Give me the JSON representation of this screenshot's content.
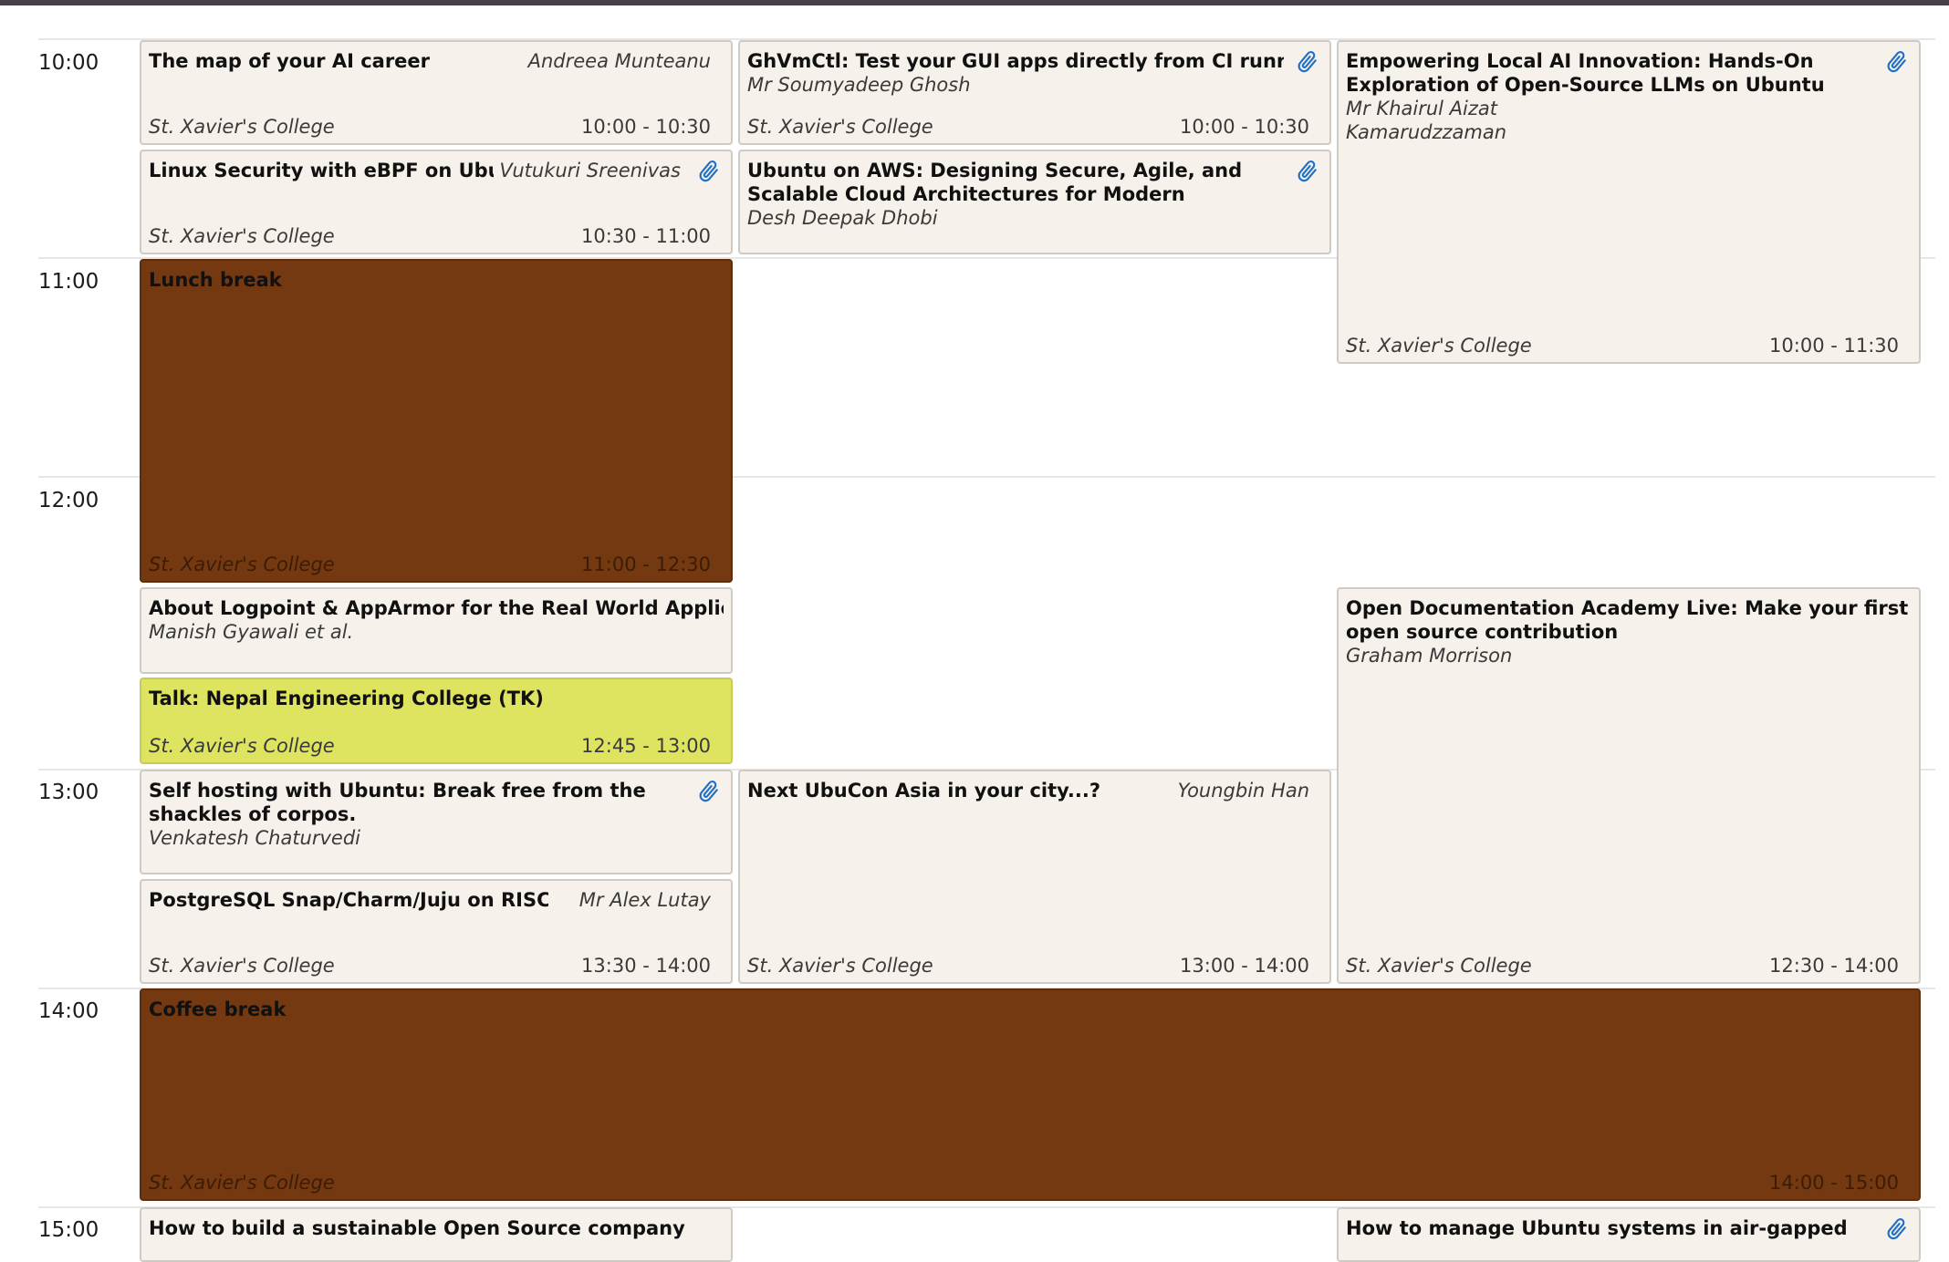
{
  "timeline": {
    "hours": [
      "10:00",
      "11:00",
      "12:00",
      "13:00",
      "14:00",
      "15:00"
    ]
  },
  "colors": {
    "event_bg": "#f6f1ea",
    "break_bg": "#743910",
    "highlight_bg": "#dfe460",
    "attachment_icon": "#1f6fc6"
  },
  "events": {
    "ai_career": {
      "title": "The map of your AI career",
      "speaker": "Andreea Munteanu",
      "location": "St. Xavier's College",
      "time": "10:00 - 10:30"
    },
    "ghvmctl": {
      "title": "GhVmCtl: Test your GUI apps directly from CI runners",
      "speaker": "Mr Soumyadeep Ghosh",
      "location": "St. Xavier's College",
      "time": "10:00 - 10:30",
      "icon": "paperclip-icon"
    },
    "local_ai": {
      "title": "Empowering Local AI Innovation: Hands-On Exploration of Open-Source LLMs on Ubuntu",
      "speaker": "Mr Khairul Aizat Kamarudzzaman",
      "location": "St. Xavier's College",
      "time": "10:00 - 11:30",
      "icon": "paperclip-icon"
    },
    "ebpf": {
      "title": "Linux Security with eBPF on Ubuntu",
      "speaker": "Vutukuri Sreenivas",
      "location": "St. Xavier's College",
      "time": "10:30 - 11:00",
      "icon": "paperclip-icon"
    },
    "aws": {
      "title": "Ubuntu on AWS: Designing Secure, Agile, and Scalable Cloud Architectures for Modern Workloads",
      "speaker": "Desh Deepak Dhobi",
      "icon": "paperclip-icon"
    },
    "lunch": {
      "title": "Lunch break",
      "location": "St. Xavier's College",
      "time": "11:00 - 12:30"
    },
    "logpoint": {
      "title": "About Logpoint & AppArmor for the Real World Application",
      "speaker": "Manish Gyawali et al."
    },
    "nepal": {
      "title": "Talk: Nepal Engineering College (TK)",
      "location": "St. Xavier's College",
      "time": "12:45 - 13:00"
    },
    "oda": {
      "title": "Open Documentation Academy Live: Make your first open source contribution",
      "speaker": "Graham Morrison",
      "location": "St. Xavier's College",
      "time": "12:30 - 14:00"
    },
    "selfhost": {
      "title": "Self hosting with Ubuntu: Break free from the shackles of corpos.",
      "speaker": "Venkatesh Chaturvedi",
      "icon": "paperclip-icon"
    },
    "ubucon": {
      "title": "Next UbuCon Asia in your city...?",
      "speaker": "Youngbin Han",
      "location": "St. Xavier's College",
      "time": "13:00 - 14:00"
    },
    "postgres": {
      "title": "PostgreSQL Snap/Charm/Juju on RISC-V",
      "speaker": "Mr Alex Lutay",
      "location": "St. Xavier's College",
      "time": "13:30 - 14:00"
    },
    "coffee": {
      "title": "Coffee break",
      "location": "St. Xavier's College",
      "time": "14:00 - 15:00"
    },
    "sustainable": {
      "title": "How to build a sustainable Open Source company"
    },
    "airgapped": {
      "title": "How to manage Ubuntu systems in air-gapped",
      "icon": "paperclip-icon"
    }
  }
}
